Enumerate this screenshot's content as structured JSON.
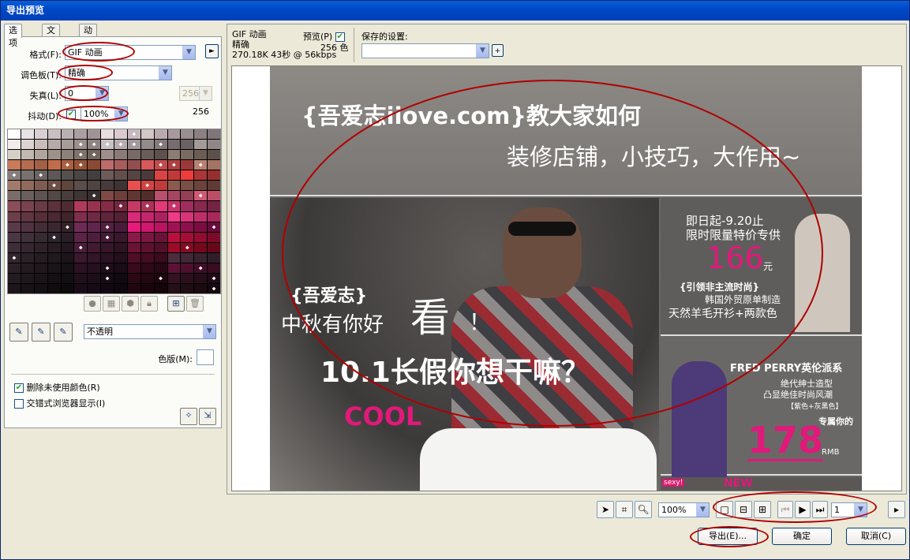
{
  "window": {
    "title": "导出预览"
  },
  "tabs": [
    {
      "label": "选项"
    },
    {
      "label": "文件"
    },
    {
      "label": "动画"
    }
  ],
  "options": {
    "format_label": "格式(F):",
    "format_value": "GIF 动画",
    "palette_label": "调色板(T):",
    "palette_value": "精确",
    "loss_label": "失真(L):",
    "loss_value": "0",
    "dither_label": "抖动(D):",
    "dither_value": "100%",
    "colors_value": "256",
    "colors_count": "256",
    "transparency_value": "不透明",
    "matte_label": "色版(M):",
    "remove_unused_label": "删除未使用颜色(R)",
    "interlace_label": "交错式浏览器显示(I)"
  },
  "palette_colors": [
    "#ffffff",
    "#e9e3e6",
    "#d9cfd2",
    "#c9bfc1",
    "#b9b0b2",
    "#ac9fa3",
    "#a09496",
    "#e9dde0",
    "#d8cad0",
    "#c6b9bf",
    "#d2c8c8",
    "#b8aaaf",
    "#a69a9e",
    "#9a8e90",
    "#8c8082",
    "#80767a",
    "#f1ece9",
    "#ddd4d1",
    "#c9bdbb",
    "#b6aba8",
    "#a89c99",
    "#9b8f8c",
    "#8f8482",
    "#c9c2c5",
    "#b6adb0",
    "#a3999c",
    "#938a8c",
    "#85797b",
    "#776d6f",
    "#6b6264",
    "#a49a98",
    "#918786",
    "#d7cec8",
    "#c3b8b1",
    "#b0a49c",
    "#9e9189",
    "#8e817a",
    "#7f736d",
    "#72665f",
    "#9f8e89",
    "#8b7b76",
    "#796a66",
    "#6a5c58",
    "#5d504d",
    "#8c7c72",
    "#7a6b62",
    "#6b5d55",
    "#5d504a",
    "#c87a5a",
    "#b56c50",
    "#a26047",
    "#c16d4b",
    "#ac5f41",
    "#985338",
    "#8a4a33",
    "#bb6b6b",
    "#a75c5c",
    "#924f4f",
    "#d65a5a",
    "#c24c4c",
    "#ae4242",
    "#9a3939",
    "#b78272",
    "#a37363",
    "#857e7c",
    "#77716f",
    "#6a6462",
    "#5e5857",
    "#54504e",
    "#4a4645",
    "#423f3e",
    "#6e5c5a",
    "#614f4d",
    "#554443",
    "#4a3b3a",
    "#d84545",
    "#c03a3a",
    "#ee3b3b",
    "#aa3636",
    "#953030",
    "#a27a6b",
    "#8f6b5d",
    "#7d5d51",
    "#6d5046",
    "#5f453c",
    "#5b4d4b",
    "#504443",
    "#463c3b",
    "#3d3433",
    "#e65050",
    "#d24444",
    "#c03b3b",
    "#8c5b4f",
    "#7a4f45",
    "#6b443c",
    "#5e3b34",
    "#7a6c6a",
    "#6b5f5d",
    "#5e5351",
    "#524846",
    "#473e3d",
    "#3e3534",
    "#362e2d",
    "#7f4a45",
    "#6e3f3b",
    "#5f3632",
    "#522e2b",
    "#b8506c",
    "#a4465f",
    "#924054",
    "#d05a74",
    "#bc4f67",
    "#8b4d5a",
    "#7a434f",
    "#6a3a45",
    "#5c323c",
    "#4f2b34",
    "#af3a5a",
    "#993250",
    "#852b46",
    "#742640",
    "#c43a64",
    "#ad3258",
    "#e23a78",
    "#c9336a",
    "#9f2e5e",
    "#88284f",
    "#752343",
    "#6d3e4a",
    "#603641",
    "#542f39",
    "#492932",
    "#40242b",
    "#7e2f4c",
    "#6e2943",
    "#60243b",
    "#542034",
    "#d82a78",
    "#c2266c",
    "#aa2260",
    "#ee3a88",
    "#d83478",
    "#c02e6a",
    "#a8285c",
    "#5a3a48",
    "#4f3340",
    "#452d38",
    "#3c2731",
    "#34222a",
    "#6e2a56",
    "#60254c",
    "#542042",
    "#481c3a",
    "#e61a7a",
    "#d0186e",
    "#b81462",
    "#a01256",
    "#8c104c",
    "#7a0e42",
    "#680c38",
    "#4a3642",
    "#40303a",
    "#382a33",
    "#30242c",
    "#2a1f26",
    "#5a2446",
    "#4e1f3d",
    "#431b35",
    "#39172d",
    "#8a1a4a",
    "#7a1642",
    "#6a1339",
    "#b8103e",
    "#a40e36",
    "#900c30",
    "#7e0a2a",
    "#3e2c38",
    "#352630",
    "#2e212a",
    "#281c24",
    "#22181f",
    "#4a1e38",
    "#3f1a30",
    "#361629",
    "#2e1322",
    "#6a1434",
    "#5e112e",
    "#520f28",
    "#9a0c28",
    "#880a22",
    "#76081e",
    "#66071a",
    "#32262e",
    "#2b2128",
    "#251c22",
    "#20181d",
    "#1b1519",
    "#3a182e",
    "#321528",
    "#2a1222",
    "#23101d",
    "#4e0e26",
    "#440c22",
    "#3a0a1d",
    "#4a2e3e",
    "#402836",
    "#37232f",
    "#2f1e28",
    "#2a2026",
    "#241b21",
    "#1f171c",
    "#1a1418",
    "#161114",
    "#2c1224",
    "#25101f",
    "#1f0d1a",
    "#1a0b16",
    "#380a1c",
    "#300818",
    "#280714",
    "#5c1236",
    "#4e102e",
    "#420e27",
    "#380c21",
    "#241b21",
    "#1e171c",
    "#1a1318",
    "#151014",
    "#120e11",
    "#20101c",
    "#1c0e18",
    "#170b14",
    "#130911",
    "#2a0814",
    "#240711",
    "#1e060e",
    "#341222",
    "#2c0f1d",
    "#250d19",
    "#1f0b15",
    "#1c1519",
    "#171215",
    "#130f12",
    "#100c0f",
    "#0d0a0c",
    "#1a0c17",
    "#160a14",
    "#120811",
    "#0f070e",
    "#20060f",
    "#1a050c",
    "#15040a",
    "#241018",
    "#1e0d14",
    "#190b11",
    "#14090e"
  ],
  "palette_marked": [
    0,
    9,
    21,
    22,
    23,
    24,
    25,
    27,
    37,
    38,
    52,
    53,
    59,
    60,
    62,
    64,
    66,
    83,
    90,
    102,
    110,
    120,
    122,
    124,
    148,
    151,
    159,
    163,
    167,
    181,
    189,
    192,
    215,
    222,
    231,
    235,
    239,
    255
  ],
  "preview": {
    "format": "GIF 动画",
    "palette": "精确",
    "stats": "270.18K 43秒 @ 56kbps",
    "preview_label": "预览(P)",
    "colors": "256 色",
    "saved_settings_label": "保存的设置:"
  },
  "banner": {
    "headline1": "{吾爱志iiove.com}教大家如何",
    "headline2": "装修店铺，小技巧，大作用~",
    "brand": "{吾爱志}",
    "midautumn": "中秋有你好",
    "look": "看",
    "exclaim": "！",
    "holiday": "10.1长假你想干嘛？",
    "cool": "COOL",
    "promo_date": "即日起-9.20止",
    "promo_limit": "限时限量特价专供",
    "price1": "166",
    "unit1": "元",
    "lead_trend": "{引领非主流时尚}",
    "korea": "韩国外贸原单制造",
    "wool": "天然羊毛开衫+两款色",
    "fredperry": "FRED PERRY英伦派系",
    "gentleman": "绝代绅士造型",
    "fashion": "凸显绝佳时尚风潮",
    "colors2": "【紫色+灰黑色】",
    "exclusive": "专属你的",
    "price2": "178",
    "rmb": "RMB",
    "sexy": "sexy!",
    "new": "NEW"
  },
  "bottom": {
    "zoom": "100%",
    "frame": "1",
    "export_label": "导出(E)...",
    "ok_label": "确定",
    "cancel_label": "取消(C)"
  },
  "colors": {
    "title_bar": "#0048c8",
    "annotation": "#b00000",
    "price": "#e0197a"
  }
}
